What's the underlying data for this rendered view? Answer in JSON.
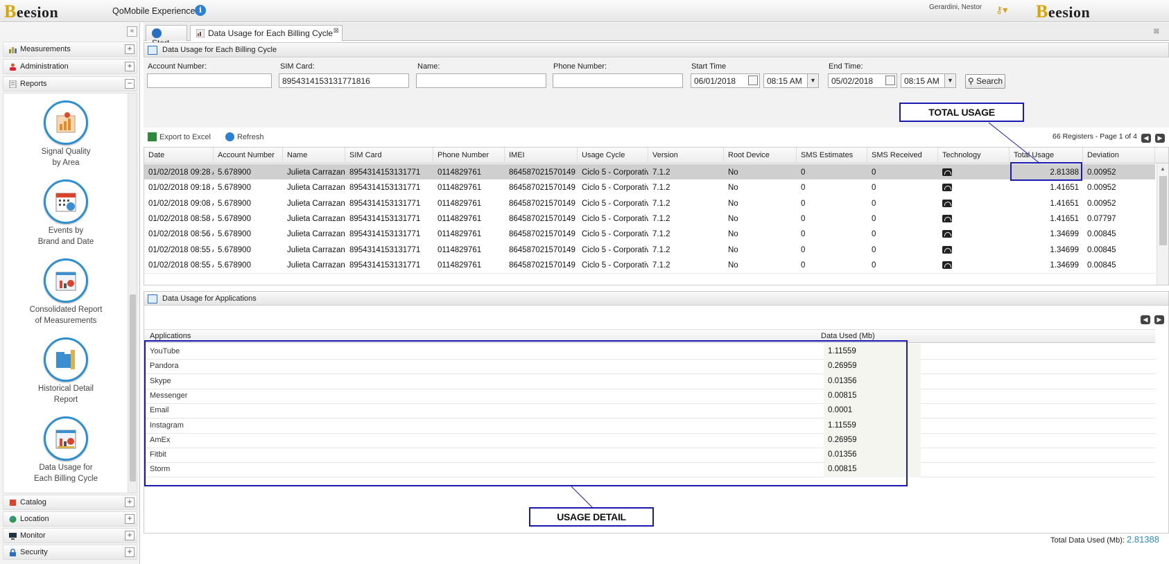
{
  "app": {
    "logo_prefix": "B",
    "logo_rest": "eesion",
    "title": "QoMobile Experience",
    "user": "Gerardini, Nestor"
  },
  "sidebar": {
    "collapse_glyph": "«",
    "top_items": [
      {
        "label": "Measurements",
        "toggle": "+"
      },
      {
        "label": "Administration",
        "toggle": "+"
      },
      {
        "label": "Reports",
        "toggle": "−"
      }
    ],
    "reports": [
      {
        "line1": "Signal Quality",
        "line2": "by Area"
      },
      {
        "line1": "Events by",
        "line2": "Brand and Date"
      },
      {
        "line1": "Consolidated Report",
        "line2": "of Measurements"
      },
      {
        "line1": "Historical Detail",
        "line2": "Report"
      },
      {
        "line1": "Data Usage for",
        "line2": "Each Billing Cycle"
      }
    ],
    "bottom_items": [
      {
        "label": "Catalog",
        "toggle": "+"
      },
      {
        "label": "Location",
        "toggle": "+"
      },
      {
        "label": "Monitor",
        "toggle": "+"
      },
      {
        "label": "Security",
        "toggle": "+"
      }
    ]
  },
  "tabs": [
    {
      "label": "Start"
    },
    {
      "label": "Data Usage for Each Billing Cycle",
      "close": "⊠"
    }
  ],
  "panel_title": "Data Usage for Each Billing Cycle",
  "filters": {
    "account_label": "Account Number:",
    "account_value": "",
    "sim_label": "SIM Card:",
    "sim_value": "8954314153131771816",
    "name_label": "Name:",
    "name_value": "",
    "phone_label": "Phone Number:",
    "phone_value": "",
    "start_label": "Start Time",
    "start_date": "06/01/2018",
    "start_time": "08:15 AM",
    "end_label": "End Time:",
    "end_date": "05/02/2018",
    "end_time": "08:15 AM",
    "search_label": "Search"
  },
  "toolbar": {
    "export": "Export to Excel",
    "refresh": "Refresh",
    "pager": "66 Registers - Page 1 of 4"
  },
  "grid": {
    "columns": [
      "Date",
      "Account Number",
      "Name",
      "SIM Card",
      "Phone Number",
      "IMEI",
      "Usage Cycle",
      "Version",
      "Root Device",
      "SMS Estimates",
      "SMS Received",
      "Technology",
      "Total Usage",
      "Deviation"
    ],
    "rows": [
      [
        "01/02/2018 09:28 A",
        "5.678900",
        "Julieta Carrazana",
        "8954314153131771",
        "0114829761",
        "864587021570149",
        "Ciclo 5 - Corporativ",
        "7.1.2",
        "No",
        "0",
        "0",
        "wifi",
        "2.81388",
        "0.00952"
      ],
      [
        "01/02/2018 09:18 A",
        "5.678900",
        "Julieta Carrazana",
        "8954314153131771",
        "0114829761",
        "864587021570149",
        "Ciclo 5 - Corporativ",
        "7.1.2",
        "No",
        "0",
        "0",
        "wifi",
        "1.41651",
        "0.00952"
      ],
      [
        "01/02/2018 09:08 A",
        "5.678900",
        "Julieta Carrazana",
        "8954314153131771",
        "0114829761",
        "864587021570149",
        "Ciclo 5 - Corporativ",
        "7.1.2",
        "No",
        "0",
        "0",
        "wifi",
        "1.41651",
        "0.00952"
      ],
      [
        "01/02/2018 08:58 A",
        "5.678900",
        "Julieta Carrazana",
        "8954314153131771",
        "0114829761",
        "864587021570149",
        "Ciclo 5 - Corporativ",
        "7.1.2",
        "No",
        "0",
        "0",
        "wifi",
        "1.41651",
        "0.07797"
      ],
      [
        "01/02/2018 08:56 A",
        "5.678900",
        "Julieta Carrazana",
        "8954314153131771",
        "0114829761",
        "864587021570149",
        "Ciclo 5 - Corporativ",
        "7.1.2",
        "No",
        "0",
        "0",
        "wifi",
        "1.34699",
        "0.00845"
      ],
      [
        "01/02/2018 08:55 A",
        "5.678900",
        "Julieta Carrazana",
        "8954314153131771",
        "0114829761",
        "864587021570149",
        "Ciclo 5 - Corporativ",
        "7.1.2",
        "No",
        "0",
        "0",
        "wifi",
        "1.34699",
        "0.00845"
      ],
      [
        "01/02/2018 08:55 A",
        "5.678900",
        "Julieta Carrazana",
        "8954314153131771",
        "0114829761",
        "864587021570149",
        "Ciclo 5 - Corporativ",
        "7.1.2",
        "No",
        "0",
        "0",
        "wifi",
        "1.34699",
        "0.00845"
      ]
    ]
  },
  "detail": {
    "title": "Data Usage for Applications",
    "col_app": "Applications",
    "col_data": "Data Used (Mb)",
    "rows": [
      {
        "app": "YouTube",
        "mb": "1.11559"
      },
      {
        "app": "Pandora",
        "mb": "0.26959"
      },
      {
        "app": "Skype",
        "mb": "0.01356"
      },
      {
        "app": "Messenger",
        "mb": "0.00815"
      },
      {
        "app": "Email",
        "mb": "0.0001"
      },
      {
        "app": "Instagram",
        "mb": "1.11559"
      },
      {
        "app": "AmEx",
        "mb": "0.26959"
      },
      {
        "app": "Fitbit",
        "mb": "0.01356"
      },
      {
        "app": "Storm",
        "mb": "0.00815"
      }
    ],
    "total_label": "Total Data Used (Mb):",
    "total_value": "2.81388"
  },
  "annotations": {
    "total_usage": "TOTAL USAGE",
    "usage_detail": "USAGE DETAIL"
  },
  "colors": {
    "accent": "#2e8fd0",
    "annotation": "#1a1ab0",
    "selected_row": "#cfcfcf"
  }
}
